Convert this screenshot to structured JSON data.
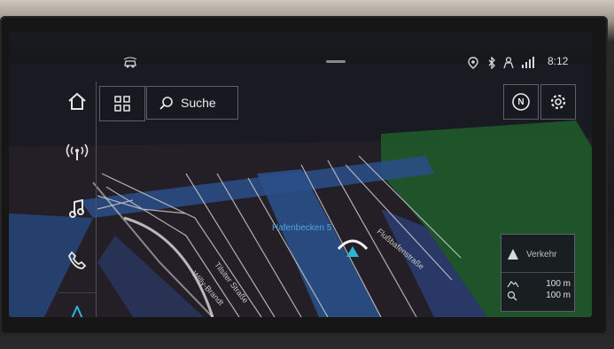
{
  "status": {
    "time": "8:12",
    "icons": [
      "assist-car-icon",
      "location-pin-icon",
      "bluetooth-icon",
      "person-icon",
      "signal-icon"
    ]
  },
  "sidebar": {
    "items": [
      {
        "name": "home",
        "icon": "home-icon"
      },
      {
        "name": "radio",
        "icon": "radio-icon"
      },
      {
        "name": "media",
        "icon": "music-note-icon"
      },
      {
        "name": "phone",
        "icon": "phone-icon"
      },
      {
        "name": "navigation",
        "icon": "navigation-arrow-icon",
        "active": true
      }
    ]
  },
  "toolbar": {
    "grid_icon": "grid-icon",
    "search_label": "Suche",
    "compass_label": "N",
    "settings_icon": "gear-icon"
  },
  "map": {
    "labels": {
      "hafenbecken": "Hafenbecken 5",
      "tilsiter": "Tilsiter Straße",
      "flussbafen": "Flußbafenstraße",
      "willy": "Willy-Brandt"
    }
  },
  "panel": {
    "traffic_label": "Verkehr",
    "row1_value": "100 m",
    "row2_value": "100 m"
  },
  "colors": {
    "accent": "#2ab6d8",
    "water": "#2a4f8a",
    "green": "#1f5a2b"
  }
}
